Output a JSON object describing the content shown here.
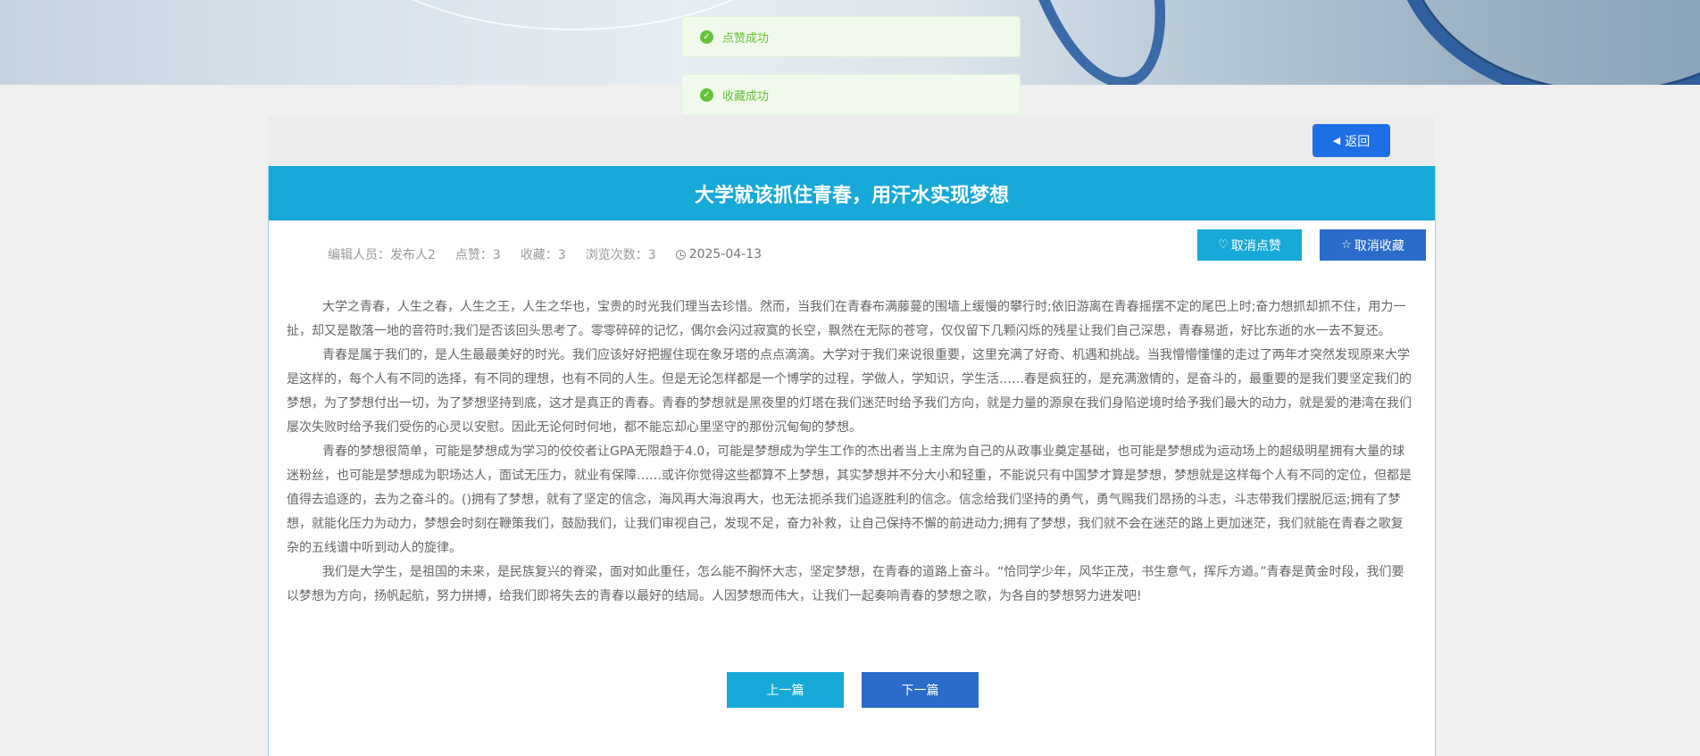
{
  "toasts": [
    {
      "text": "点赞成功"
    },
    {
      "text": "收藏成功"
    }
  ],
  "topbar": {
    "back_label": "返回"
  },
  "article": {
    "title": "大学就该抓住青春，用汗水实现梦想",
    "meta": {
      "editor": "编辑人员：发布人2",
      "likes": "点赞：3",
      "favorites": "收藏：3",
      "views": "浏览次数：3",
      "date": "2025-04-13"
    },
    "actions": {
      "unlike_label": "取消点赞",
      "unfavorite_label": "取消收藏"
    },
    "paragraphs": [
      "大学之青春，人生之春，人生之王，人生之华也，宝贵的时光我们理当去珍惜。然而，当我们在青春布满藤蔓的围墙上缓慢的攀行时;依旧游离在青春摇摆不定的尾巴上时;奋力想抓却抓不住，用力一扯，却又是散落一地的音符时;我们是否该回头思考了。零零碎碎的记忆，偶尔会闪过寂寞的长空，飘然在无际的苍穹，仅仅留下几颗闪烁的残星让我们自己深思，青春易逝，好比东逝的水一去不复还。",
      "青春是属于我们的，是人生最最美好的时光。我们应该好好把握住现在象牙塔的点点滴滴。大学对于我们来说很重要，这里充满了好奇、机遇和挑战。当我懵懵懂懂的走过了两年才突然发现原来大学是这样的，每个人有不同的选择，有不同的理想，也有不同的人生。但是无论怎样都是一个博学的过程，学做人，学知识，学生活……春是疯狂的，是充满激情的，是奋斗的，最重要的是我们要坚定我们的梦想，为了梦想付出一切，为了梦想坚持到底，这才是真正的青春。青春的梦想就是黑夜里的灯塔在我们迷茫时给予我们方向，就是力量的源泉在我们身陷逆境时给予我们最大的动力，就是爱的港湾在我们屡次失败时给予我们受伤的心灵以安慰。因此无论何时何地，都不能忘却心里坚守的那份沉甸甸的梦想。",
      "青春的梦想很简单，可能是梦想成为学习的佼佼者让GPA无限趋于4.0，可能是梦想成为学生工作的杰出者当上主席为自己的从政事业奠定基础，也可能是梦想成为运动场上的超级明星拥有大量的球迷粉丝，也可能是梦想成为职场达人，面试无压力，就业有保障……或许你觉得这些都算不上梦想，其实梦想并不分大小和轻重，不能说只有中国梦才算是梦想，梦想就是这样每个人有不同的定位，但都是值得去追逐的，去为之奋斗的。()拥有了梦想，就有了坚定的信念，海风再大海浪再大，也无法扼杀我们追逐胜利的信念。信念给我们坚持的勇气，勇气赐我们昂扬的斗志，斗志带我们摆脱厄运;拥有了梦想，就能化压力为动力，梦想会时刻在鞭策我们，鼓励我们，让我们审视自己，发现不足，奋力补救，让自己保持不懈的前进动力;拥有了梦想，我们就不会在迷茫的路上更加迷茫，我们就能在青春之歌复杂的五线谱中听到动人的旋律。",
      "我们是大学生，是祖国的未来，是民族复兴的脊梁，面对如此重任，怎么能不胸怀大志，坚定梦想，在青春的道路上奋斗。“恰同学少年，风华正茂，书生意气，挥斥方遒。”青春是黄金时段，我们要以梦想为方向，扬帆起航，努力拼搏，给我们即将失去的青春以最好的结局。人因梦想而伟大，让我们一起奏响青春的梦想之歌，为各自的梦想努力进发吧!"
    ]
  },
  "pager": {
    "prev_label": "上一篇",
    "next_label": "下一篇"
  },
  "colors": {
    "primary": "#17a9d8",
    "accent": "#2b6bc9",
    "back": "#1e6fe6",
    "success": "#67c23a"
  }
}
